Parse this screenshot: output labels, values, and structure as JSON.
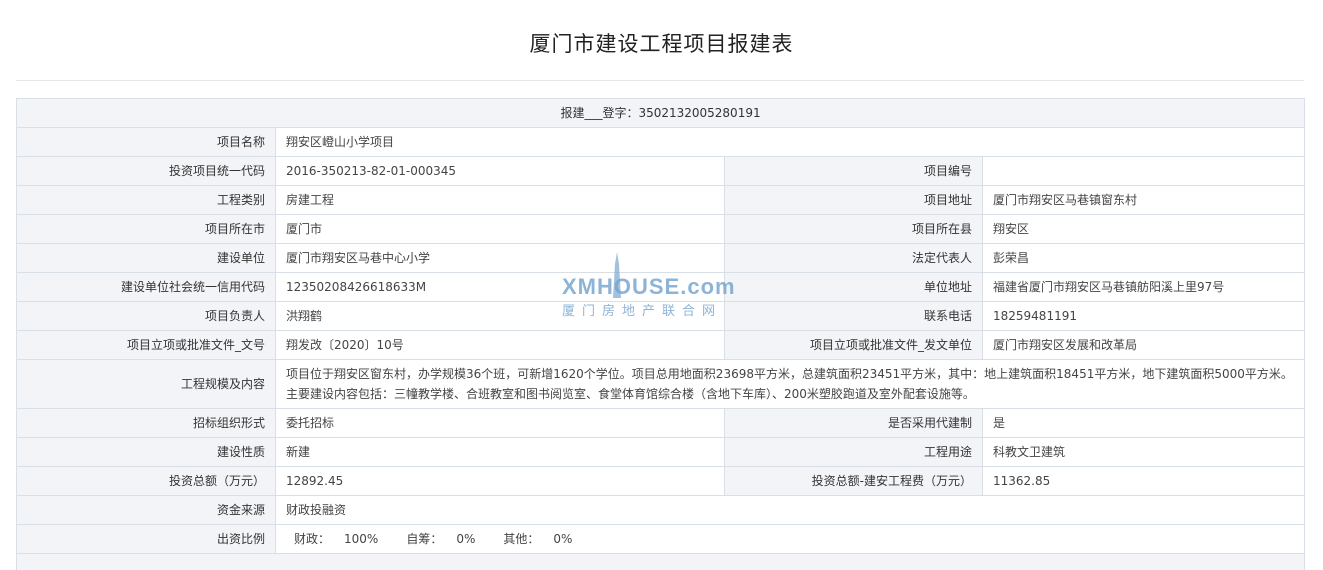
{
  "page": {
    "title": "厦门市建设工程项目报建表"
  },
  "registration": {
    "text": "报建___登字：3502132005280191"
  },
  "rows": {
    "project_name": {
      "label": "项目名称",
      "value": "翔安区嶝山小学项目"
    },
    "unified_code": {
      "label": "投资项目统一代码",
      "value": "2016-350213-82-01-000345",
      "label2": "项目编号",
      "value2": ""
    },
    "category": {
      "label": "工程类别",
      "value": "房建工程",
      "label2": "项目地址",
      "value2": "厦门市翔安区马巷镇窗东村"
    },
    "city": {
      "label": "项目所在市",
      "value": "厦门市",
      "label2": "项目所在县",
      "value2": "翔安区"
    },
    "builder": {
      "label": "建设单位",
      "value": "厦门市翔安区马巷中心小学",
      "label2": "法定代表人",
      "value2": "彭荣昌"
    },
    "credit_code": {
      "label": "建设单位社会统一信用代码",
      "value": "12350208426618633M",
      "label2": "单位地址",
      "value2": "福建省厦门市翔安区马巷镇舫阳溪上里97号"
    },
    "leader": {
      "label": "项目负责人",
      "value": "洪翔鹤",
      "label2": "联系电话",
      "value2": "18259481191"
    },
    "approval": {
      "label": "项目立项或批准文件_文号",
      "value": "翔发改〔2020〕10号",
      "label2": "项目立项或批准文件_发文单位",
      "value2": "厦门市翔安区发展和改革局"
    },
    "scale": {
      "label": "工程规模及内容",
      "value": "项目位于翔安区窗东村，办学规模36个班，可新增1620个学位。项目总用地面积23698平方米，总建筑面积23451平方米，其中：地上建筑面积18451平方米，地下建筑面积5000平方米。主要建设内容包括：三幢教学楼、合班教室和图书阅览室、食堂体育馆综合楼（含地下车库）、200米塑胶跑道及室外配套设施等。"
    },
    "bidding": {
      "label": "招标组织形式",
      "value": "委托招标",
      "label2": "是否采用代建制",
      "value2": "是"
    },
    "nature": {
      "label": "建设性质",
      "value": "新建",
      "label2": "工程用途",
      "value2": "科教文卫建筑"
    },
    "investment": {
      "label": "投资总额（万元）",
      "value": "12892.45",
      "label2": "投资总额-建安工程费（万元）",
      "value2": "11362.85"
    },
    "funding": {
      "label": "资金来源",
      "value": "财政投融资"
    },
    "ratio": {
      "label": "出资比例",
      "items": [
        {
          "key": "财政：",
          "value": "100%"
        },
        {
          "key": "自筹：",
          "value": "0%"
        },
        {
          "key": "其他：",
          "value": "0%"
        }
      ]
    }
  },
  "watermark": {
    "brand": "XMHOUSE.com",
    "subtitle": "厦门房地产联合网"
  },
  "colors": {
    "label_bg": "#f2f4f7",
    "border": "#d9dfe6",
    "watermark": "#7aa7cf"
  }
}
